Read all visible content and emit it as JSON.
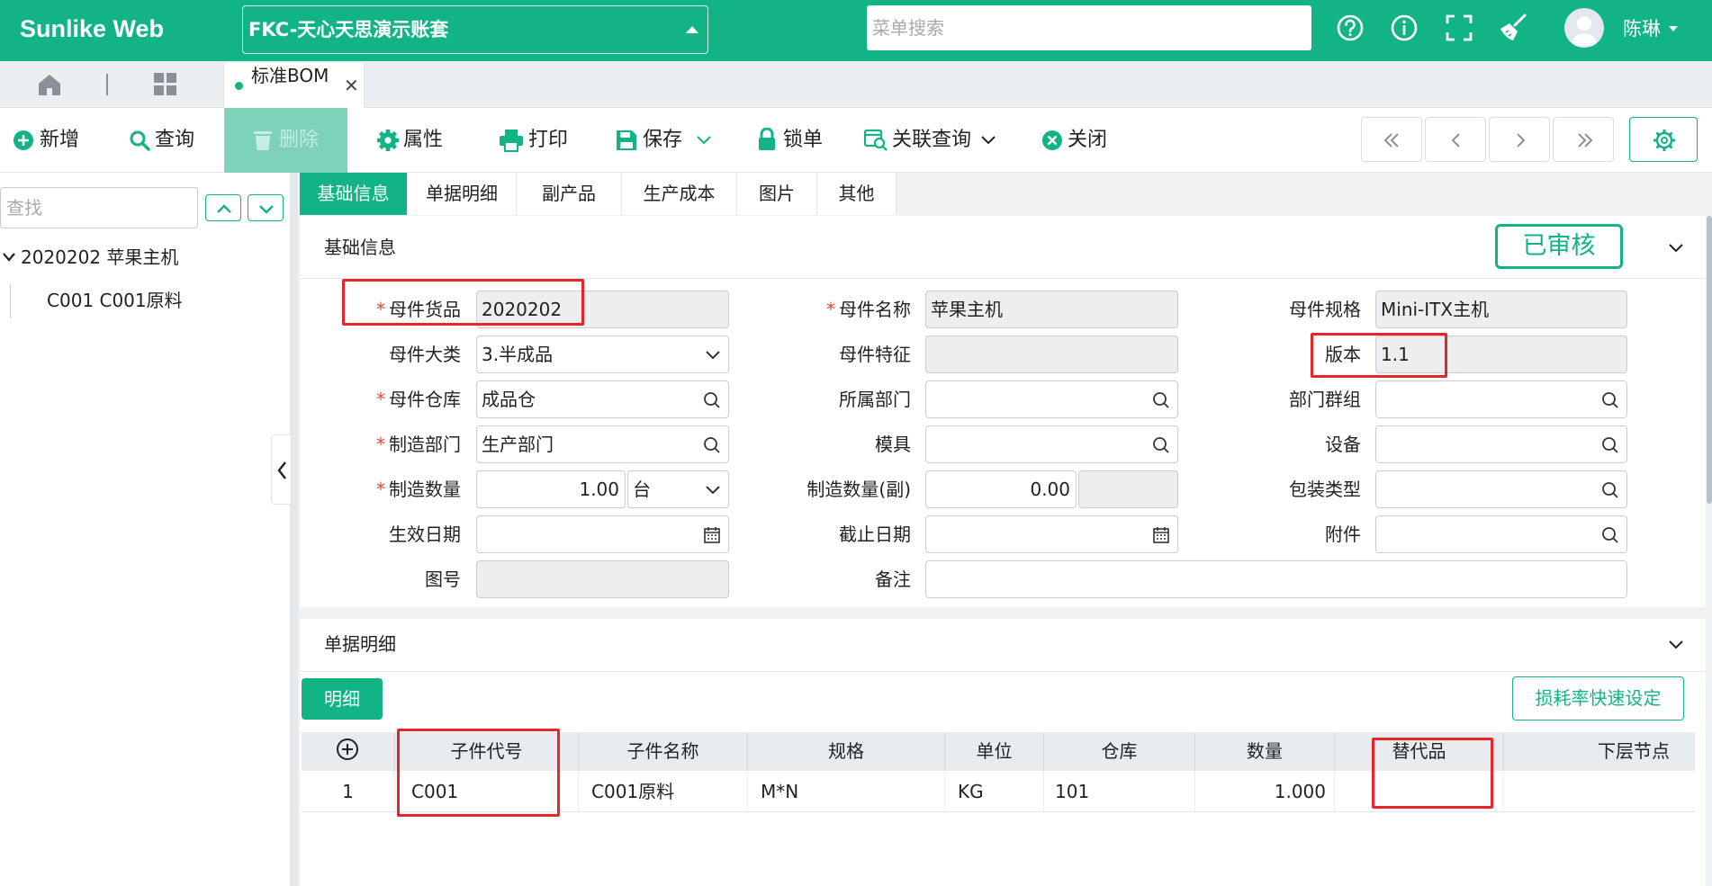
{
  "header": {
    "brand": "Sunlike Web",
    "account": "FKC-天心天思演示账套",
    "search_placeholder": "菜单搜索",
    "user_name": "陈琳",
    "icons": [
      "help-circle-icon",
      "info-icon",
      "fullscreen-icon",
      "broom-icon"
    ]
  },
  "tabs": {
    "open_tab": "标准BOM"
  },
  "toolbar": {
    "new": "新增",
    "query": "查询",
    "delete": "删除",
    "properties": "属性",
    "print": "打印",
    "save": "保存",
    "lock": "锁单",
    "related_query": "关联查询",
    "close": "关闭"
  },
  "tree": {
    "search_placeholder": "查找",
    "root": "2020202 苹果主机",
    "child": "C001 C001原料"
  },
  "form_tabs": [
    "基础信息",
    "单据明细",
    "副产品",
    "生产成本",
    "图片",
    "其他"
  ],
  "basic": {
    "title": "基础信息",
    "status": "已审核",
    "labels": {
      "parent_item": "母件货品",
      "parent_name": "母件名称",
      "parent_spec": "母件规格",
      "parent_category": "母件大类",
      "parent_feature": "母件特征",
      "version": "版本",
      "parent_warehouse": "母件仓库",
      "dept": "所属部门",
      "dept_group": "部门群组",
      "mfg_dept": "制造部门",
      "mold": "模具",
      "equipment": "设备",
      "mfg_qty": "制造数量",
      "mfg_qty_sub": "制造数量(副)",
      "pack_type": "包装类型",
      "effective_date": "生效日期",
      "end_date": "截止日期",
      "attachment": "附件",
      "drawing_no": "图号",
      "remark": "备注"
    },
    "values": {
      "parent_item": "2020202",
      "parent_name": "苹果主机",
      "parent_spec": "Mini-ITX主机",
      "parent_category": "3.半成品",
      "version": "1.1",
      "parent_warehouse": "成品仓",
      "mfg_dept": "生产部门",
      "mfg_qty": "1.00",
      "mfg_unit": "台",
      "mfg_qty_sub": "0.00"
    }
  },
  "detail": {
    "title": "单据明细",
    "detail_button": "明细",
    "loss_rate_button": "损耗率快速设定",
    "columns": [
      "子件代号",
      "子件名称",
      "规格",
      "单位",
      "仓库",
      "数量",
      "替代品",
      "下层节点"
    ],
    "rows": [
      {
        "no": "1",
        "code": "C001",
        "name": "C001原料",
        "spec": "M*N",
        "unit": "KG",
        "warehouse": "101",
        "qty": "1.000",
        "substitute": "",
        "child_node": ""
      }
    ]
  },
  "colors": {
    "brand": "#12b486",
    "required": "#e2473f",
    "highlight": "#e8262a"
  }
}
